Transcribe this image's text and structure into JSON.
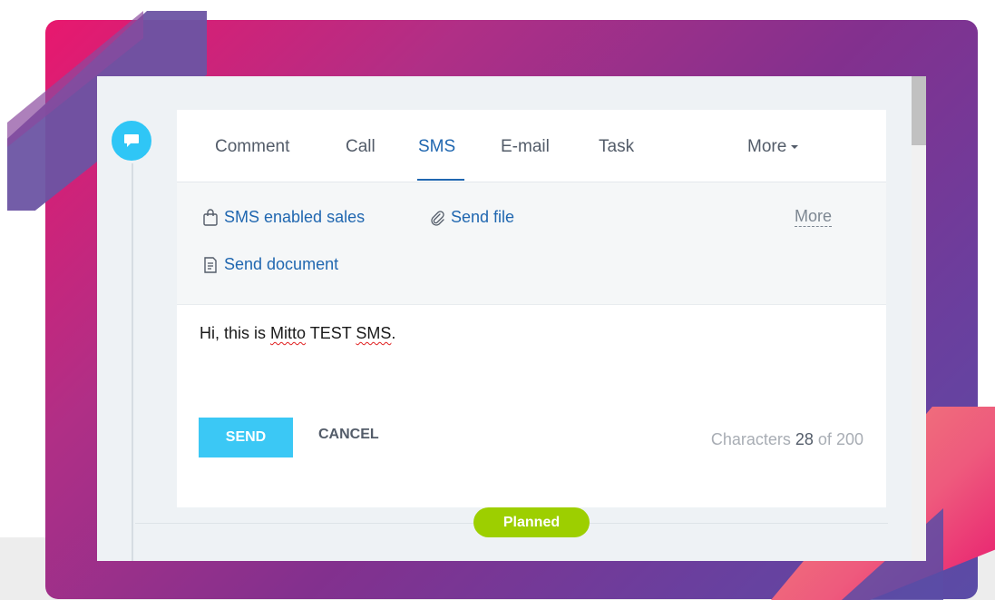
{
  "tabs": {
    "items": [
      {
        "label": "Comment"
      },
      {
        "label": "Call"
      },
      {
        "label": "SMS"
      },
      {
        "label": "E-mail"
      },
      {
        "label": "Task"
      }
    ],
    "active": "SMS",
    "more_label": "More"
  },
  "tools": {
    "sms_sales_label": "SMS enabled sales",
    "send_file_label": "Send file",
    "send_document_label": "Send document",
    "more_label": "More"
  },
  "message": {
    "prefix": "Hi, this is ",
    "word_1": "Mitto",
    "middle": " TEST ",
    "word_2": "SMS",
    "suffix": "."
  },
  "actions": {
    "send_label": "SEND",
    "cancel_label": "CANCEL"
  },
  "counter": {
    "label": "Characters",
    "current": "28",
    "of_label": "of",
    "max": "200"
  },
  "status": {
    "badge_label": "Planned"
  },
  "colors": {
    "accent": "#2067b0",
    "send_button": "#3bc8f5",
    "timeline_icon": "#2fc6f6",
    "planned_badge": "#9dcf00"
  },
  "icons": {
    "timeline": "chat-bubble-icon",
    "sms_sales": "shopping-bag-icon",
    "send_file": "paperclip-icon",
    "send_document": "document-icon"
  }
}
